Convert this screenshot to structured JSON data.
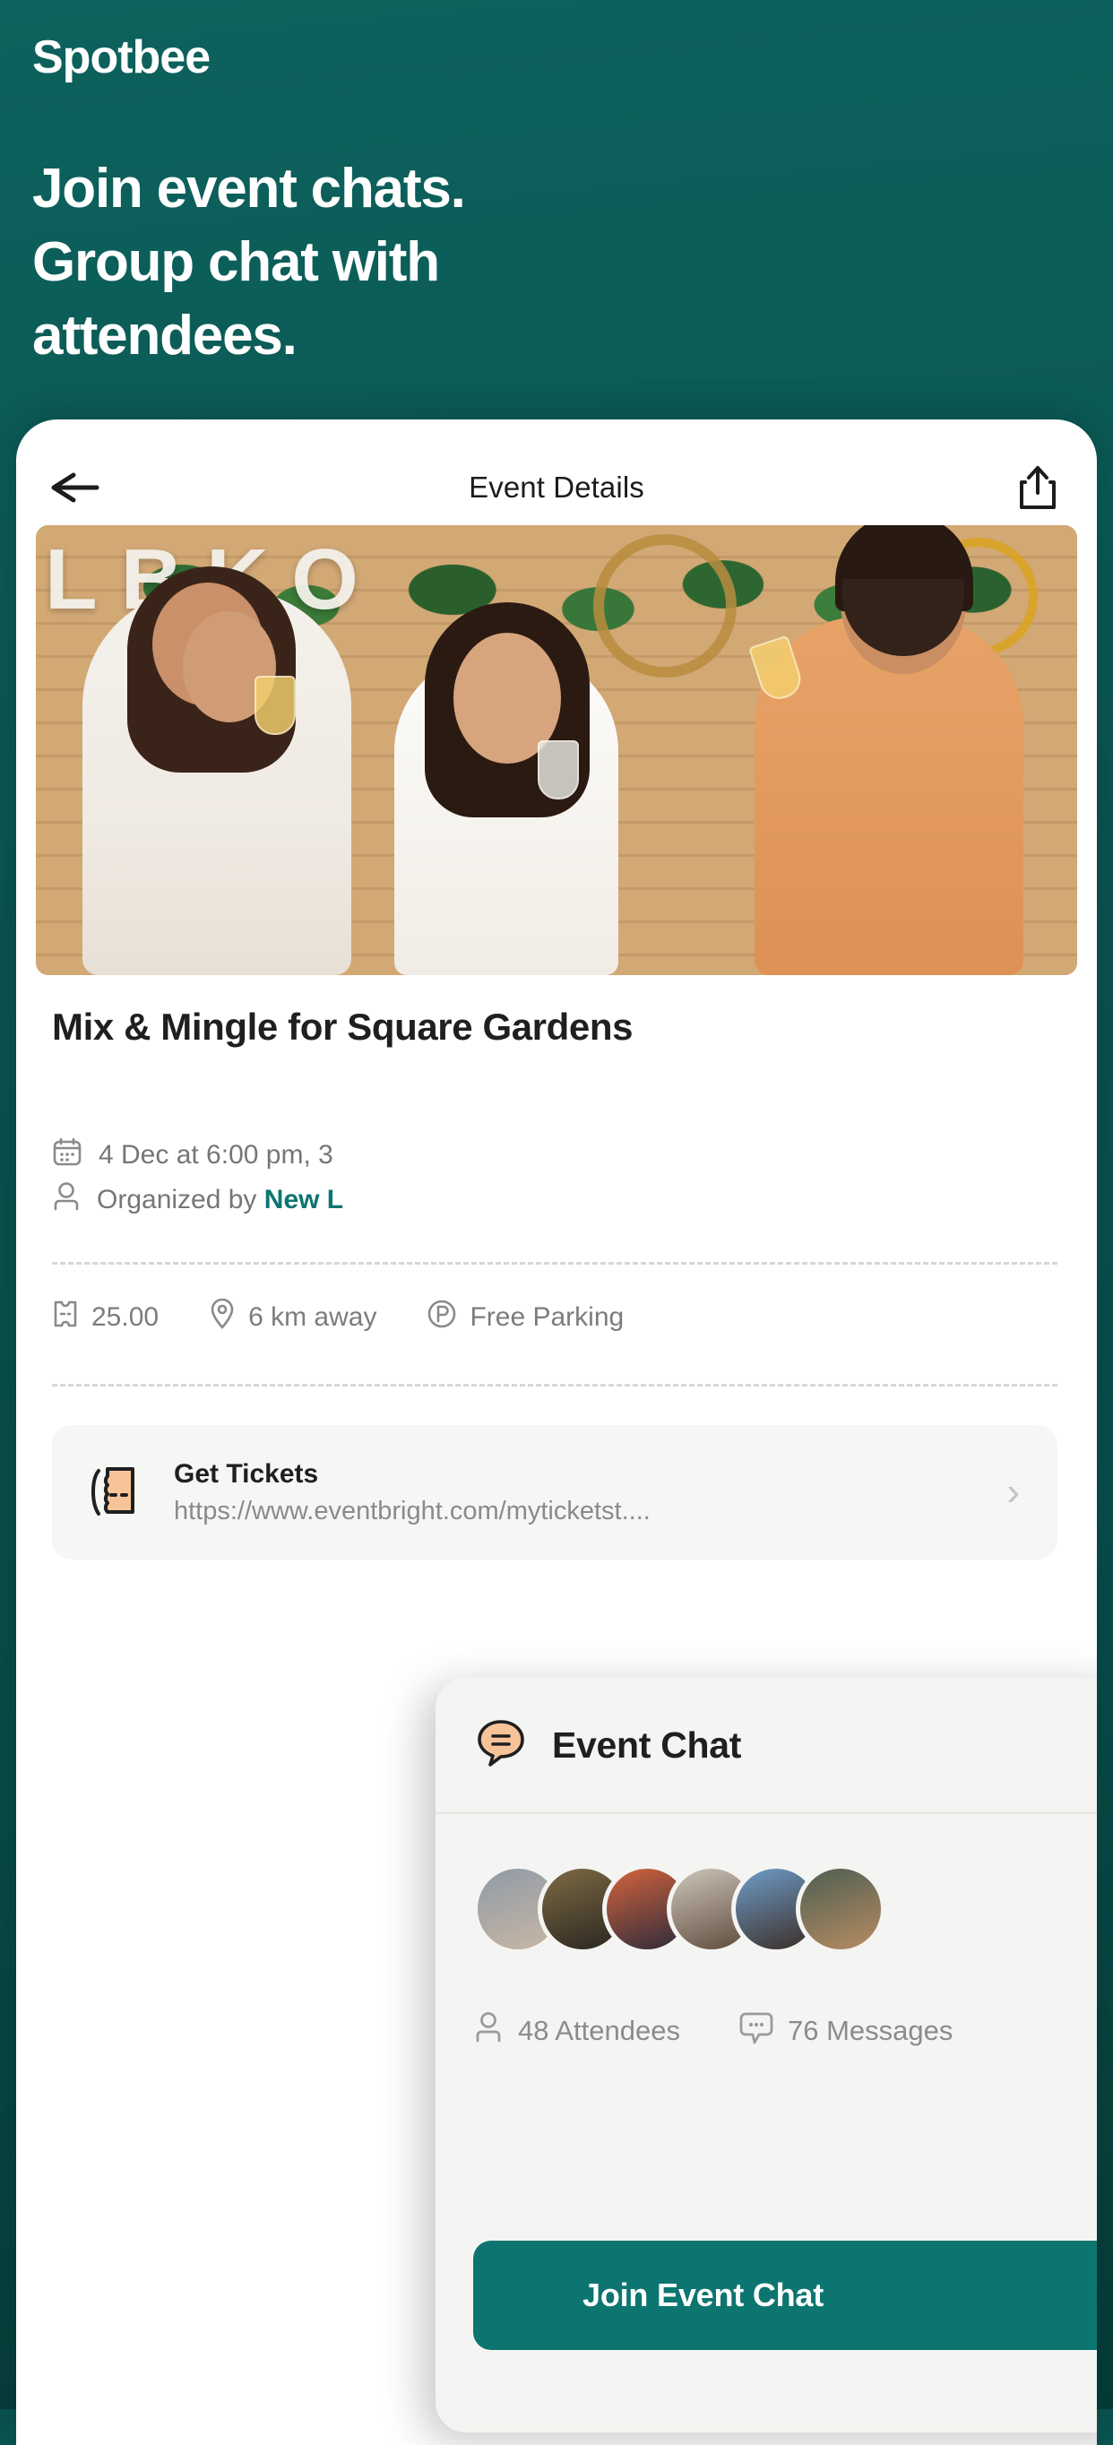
{
  "promo": {
    "brand": "Spotbee",
    "headline": "Join event chats. Group chat with attendees."
  },
  "phone": {
    "topbar": {
      "back_icon": "arrow-left-icon",
      "title": "Event Details",
      "share_icon": "share-icon"
    },
    "hero": {
      "wall_letters": "LBKO",
      "alt": "Three people laughing with drinks at an indoor bar event"
    },
    "event": {
      "title": "Mix & Mingle for Square Gardens",
      "date": "4 Dec at 6:00 pm, 3",
      "organizer_prefix": "Organized by ",
      "organizer_name": "New L",
      "facts": [
        {
          "icon": "ticket-icon",
          "label": "25.00"
        },
        {
          "icon": "map-pin-icon",
          "label": "6 km away"
        },
        {
          "icon": "parking-icon",
          "label": "Free Parking"
        }
      ]
    },
    "tickets": {
      "icon": "ticket-stub-icon",
      "title": "Get Tickets",
      "url": "https://www.eventbright.com/myticketst....",
      "chevron": "chevron-right-icon"
    }
  },
  "chat_card": {
    "icon": "chat-bubble-icon",
    "title": "Event Chat",
    "attendees": {
      "icon": "person-icon",
      "label": "48 Attendees",
      "count": 48
    },
    "messages": {
      "icon": "message-icon",
      "label": "76 Messages",
      "count": 76
    },
    "avatar_count": 6,
    "join_button": "Join Event Chat"
  },
  "colors": {
    "brand_teal": "#0d7570",
    "promo_bg": "#0a5450",
    "accent_peach": "#f7c49a",
    "muted_text": "#8a8a8e",
    "card_bg": "#f4f4f2"
  }
}
